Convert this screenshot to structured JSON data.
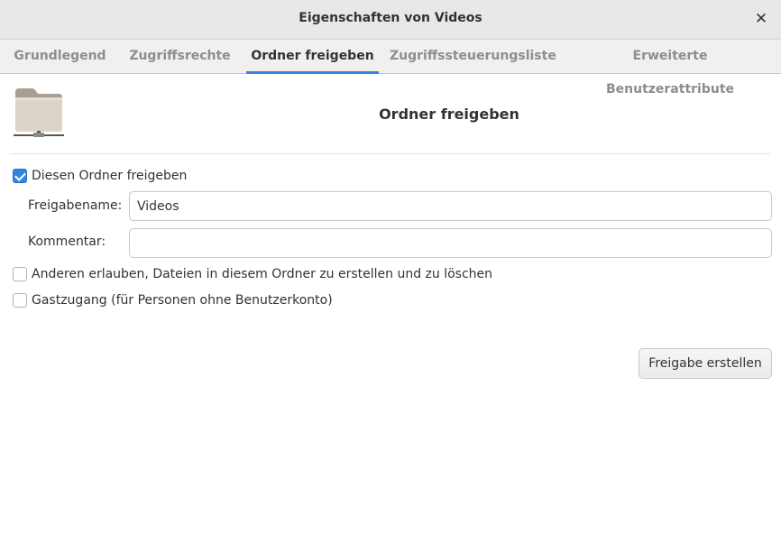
{
  "window": {
    "title": "Eigenschaften von Videos",
    "close_icon": "close-icon"
  },
  "tabs": [
    {
      "label": "Grundlegend",
      "active": false
    },
    {
      "label": "Zugriffsrechte",
      "active": false
    },
    {
      "label": "Ordner freigeben",
      "active": true
    },
    {
      "label": "Zugriffssteuerungsliste",
      "active": false
    },
    {
      "label": "Erweiterte Benutzerattribute",
      "active": false
    }
  ],
  "header": {
    "icon": "folder-network-icon",
    "title": "Ordner freigeben"
  },
  "share": {
    "share_checkbox": {
      "label": "Diesen Ordner freigeben",
      "checked": true
    },
    "name_label": "Freigabename:",
    "name_value": "Videos",
    "comment_label": "Kommentar:",
    "comment_value": "",
    "allow_write_checkbox": {
      "label": "Anderen erlauben, Dateien in diesem Ordner zu erstellen und zu löschen",
      "checked": false
    },
    "guest_checkbox": {
      "label": "Gastzugang (für Personen ohne Benutzerkonto)",
      "checked": false
    },
    "create_button": "Freigabe erstellen"
  },
  "colors": {
    "accent": "#3584e4",
    "titlebar": "#e8e8e7",
    "tabbar": "#f1f0ef",
    "text": "#2e3436",
    "inactive_tab_text": "#8b8e8f"
  }
}
